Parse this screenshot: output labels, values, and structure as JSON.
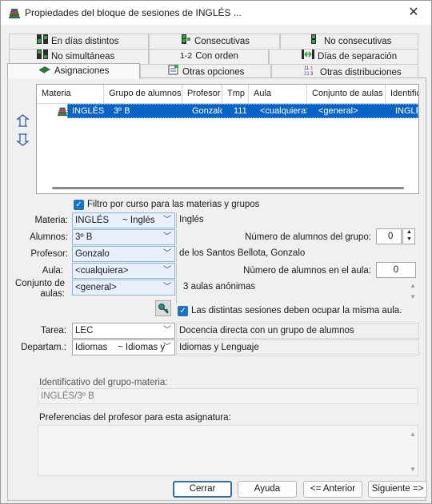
{
  "window": {
    "title": "Propiedades del bloque de sesiones de INGLÉS ...",
    "close_glyph": "✕"
  },
  "tabs": {
    "row1": [
      {
        "label": "En días distintos",
        "icon": "days-icon"
      },
      {
        "label": "Consecutivas",
        "icon": "consecutive-icon"
      },
      {
        "label": "No consecutivas",
        "icon": "non-consecutive-icon"
      }
    ],
    "row2": [
      {
        "label": "No simultáneas",
        "icon": "non-simultaneous-icon"
      },
      {
        "label": "Con orden",
        "icon_text": "1-2"
      },
      {
        "label": "Días de separación",
        "icon": "separation-icon"
      }
    ],
    "row3": [
      {
        "label": "Asignaciones",
        "icon": "book-icon"
      },
      {
        "label": "Otras opciones",
        "icon": "options-icon"
      },
      {
        "label": "Otras distribuciones",
        "icon_text": "11 21 3"
      }
    ]
  },
  "grid": {
    "headers": [
      "Materia",
      "Grupo de alumnos",
      "Profesor",
      "Tmp",
      "Aula",
      "Conjunto de aulas",
      "Identific"
    ],
    "row": [
      "INGLÉS",
      "3º B",
      "Gonzalo",
      "111",
      "<cualquiera>",
      "<general>",
      "INGLÉ"
    ]
  },
  "form": {
    "filter_label": "Filtro por curso para las materias y grupos",
    "materia_label": "Materia:",
    "materia_value": "INGLÉS",
    "materia_alias": "~ Inglés",
    "materia_desc": "Inglés",
    "alumnos_label": "Alumnos:",
    "alumnos_value": "3º B",
    "num_alumnos_label": "Número de alumnos del grupo:",
    "num_alumnos_value": "0",
    "profesor_label": "Profesor:",
    "profesor_value": "Gonzalo",
    "profesor_desc": "de los Santos Bellota, Gonzalo",
    "aula_label": "Aula:",
    "aula_value": "<cualquiera>",
    "num_aula_label": "Número de alumnos en el aula:",
    "num_aula_value": "0",
    "conjunto_label_1": "Conjunto de",
    "conjunto_label_2": "aulas:",
    "conjunto_value": "<general>",
    "conjunto_desc": "3 aulas anónimas",
    "misma_aula_label": "Las distintas sesiones deben ocupar la misma aula.",
    "tarea_label": "Tarea:",
    "tarea_value": "LEC",
    "tarea_desc": "Docencia directa con un grupo de alumnos",
    "depart_label": "Departam.:",
    "depart_value": "Idiomas",
    "depart_alias": "~ Idiomas y",
    "depart_desc": "Idiomas y Lenguaje",
    "ident_label": "Identificativo del grupo-materia:",
    "ident_value": "INGLÉS/3º B",
    "prefs_label": "Preferencias del profesor para esta asignatura:"
  },
  "buttons": {
    "close": "Cerrar",
    "help": "Ayuda",
    "prev": "<= Anterior",
    "next": "Siguiente =>"
  },
  "colors": {
    "selection": "#0a64c8",
    "accent": "#1a73c9",
    "default_button_border": "#2f6fb3"
  }
}
